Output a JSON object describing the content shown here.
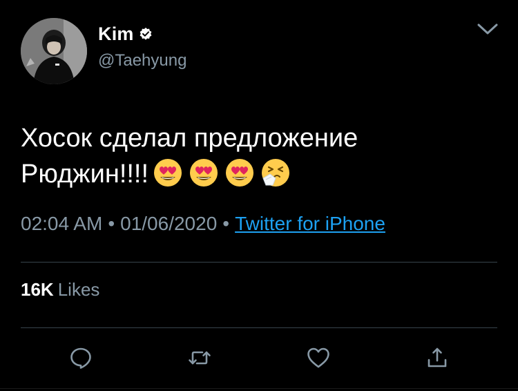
{
  "tweet": {
    "author": {
      "display_name": "Kim",
      "handle": "@Taehyung",
      "verified": true
    },
    "text_line_1": "Хосок сделал предложение",
    "text_line_2": "Рюджин!!!!",
    "emojis": [
      "heart-eyes-emoji",
      "heart-eyes-emoji",
      "heart-eyes-emoji",
      "sneezing-face-emoji"
    ],
    "time": "02:04 AM",
    "separator": "•",
    "date": "01/06/2020",
    "source": "Twitter for iPhone",
    "likes_count": "16K",
    "likes_label": "Likes"
  },
  "actions": [
    "reply-icon",
    "retweet-icon",
    "like-icon",
    "share-icon"
  ],
  "colors": {
    "background": "#000000",
    "text": "#ffffff",
    "muted": "#8899a6",
    "link": "#1da1f2",
    "divider": "#38444d"
  }
}
